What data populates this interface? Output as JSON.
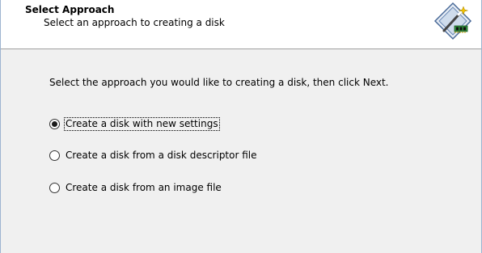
{
  "header": {
    "title": "Select Approach",
    "subtitle": "Select an approach to creating a disk",
    "icon": "disk-wizard-icon"
  },
  "main": {
    "instruction": "Select the approach you would like to creating a disk, then click Next.",
    "options": [
      {
        "label": "Create a disk with new settings",
        "selected": true
      },
      {
        "label": "Create a disk from a disk descriptor file",
        "selected": false
      },
      {
        "label": "Create a disk from an image file",
        "selected": false
      }
    ]
  },
  "colors": {
    "header_bg": "#ffffff",
    "body_bg": "#f0f0f0",
    "separator": "#a0a0a0"
  }
}
